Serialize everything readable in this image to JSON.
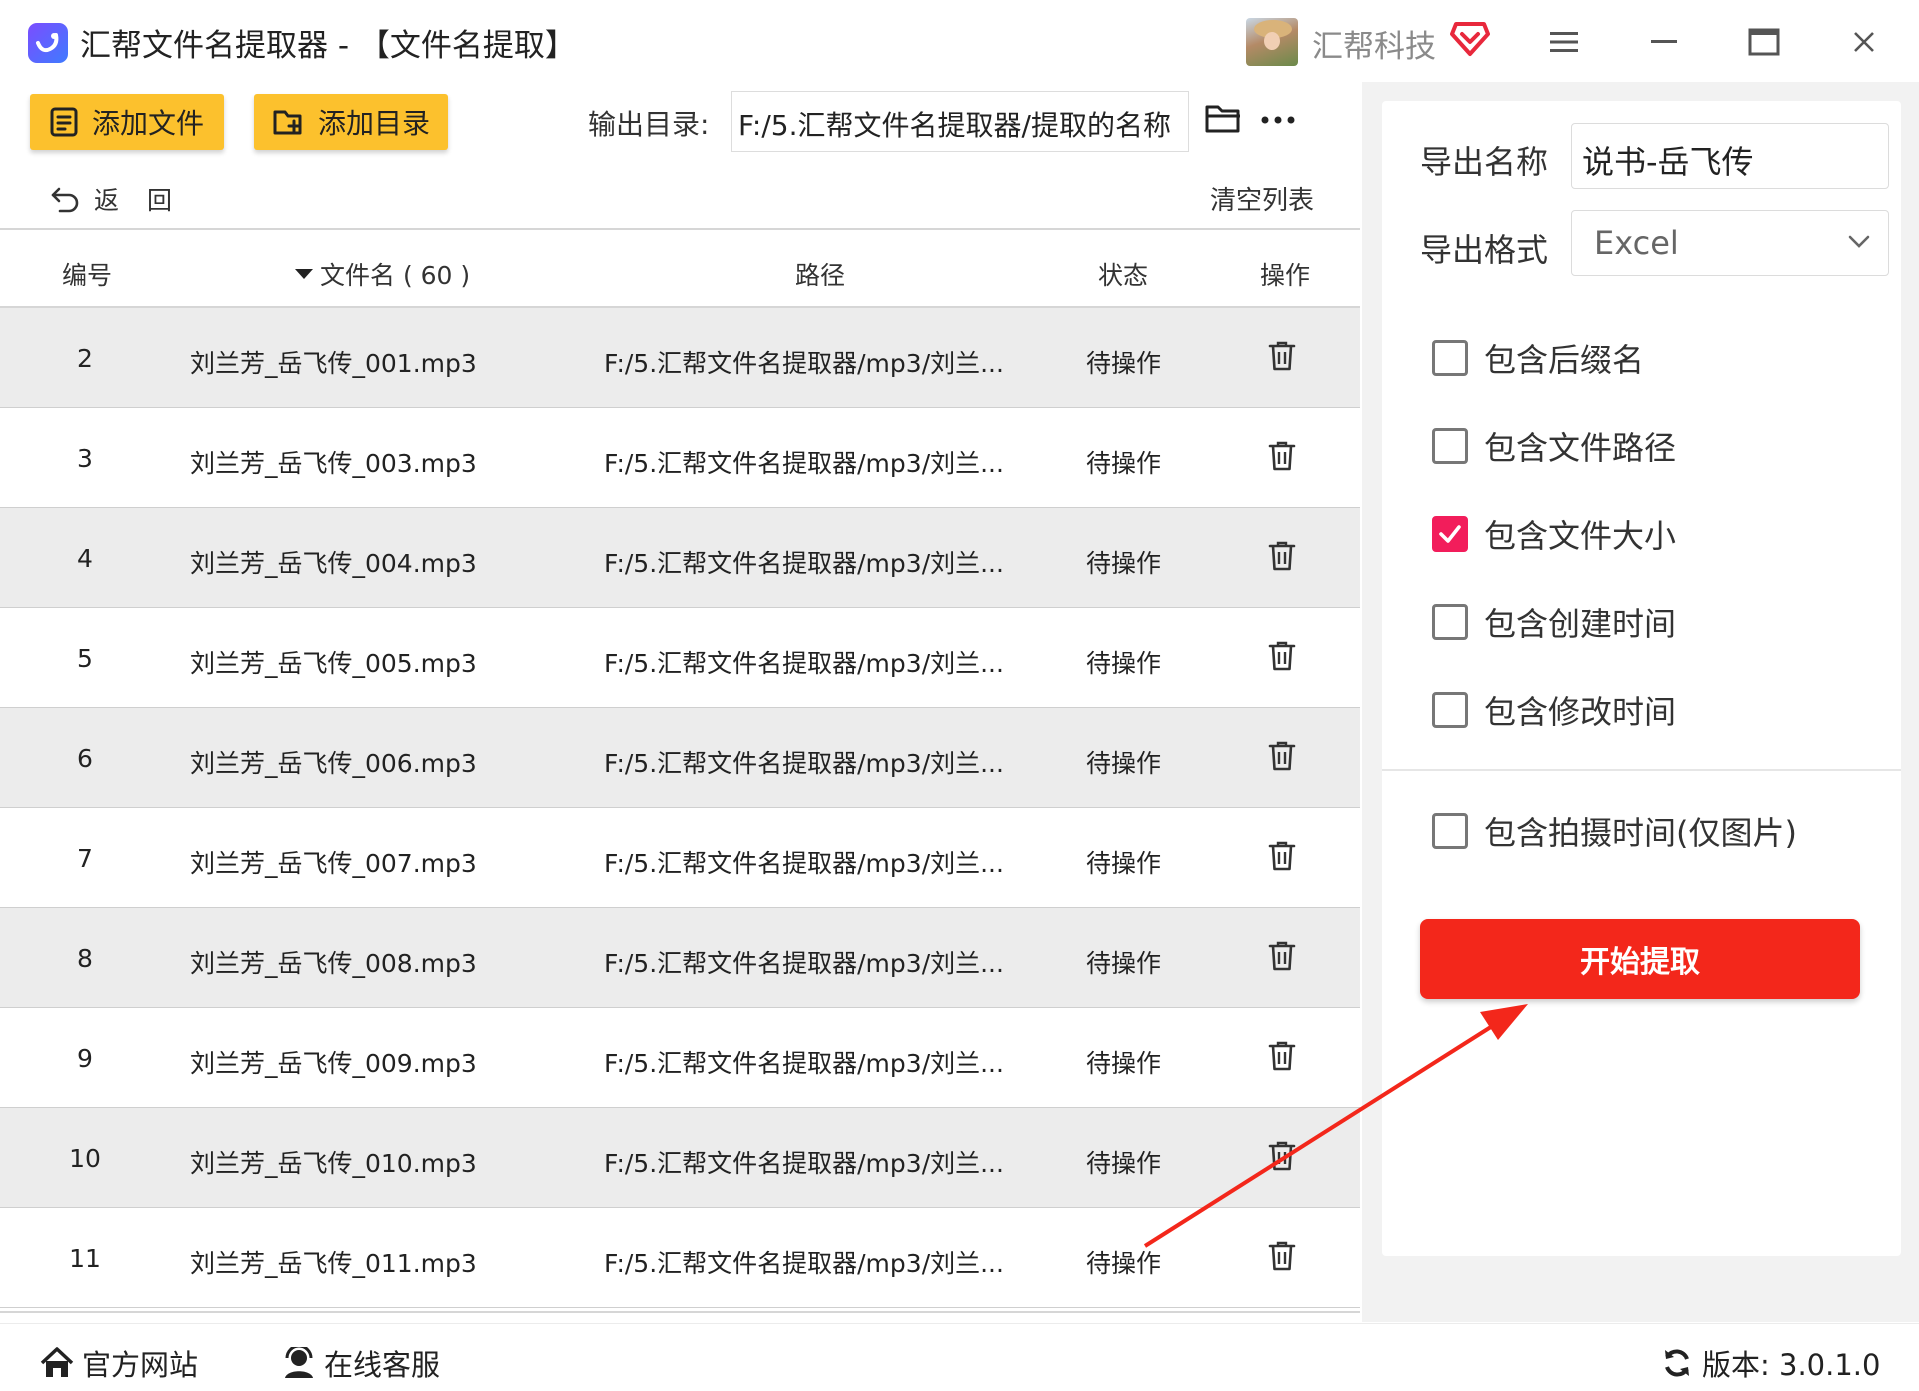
{
  "window": {
    "title": "汇帮文件名提取器 - 【文件名提取】",
    "company": "汇帮科技"
  },
  "toolbar": {
    "add_file_label": "添加文件",
    "add_dir_label": "添加目录",
    "output_label": "输出目录:",
    "output_value": "F:/5.汇帮文件名提取器/提取的名称",
    "back_label": "返 回",
    "clear_label": "清空列表"
  },
  "table": {
    "headers": {
      "num": "编号",
      "name": "文件名 ( 60 )",
      "path": "路径",
      "status": "状态",
      "op": "操作"
    },
    "rows": [
      {
        "num": "2",
        "name": "刘兰芳_岳飞传_001.mp3",
        "path": "F:/5.汇帮文件名提取器/mp3/刘兰...",
        "status": "待操作"
      },
      {
        "num": "3",
        "name": "刘兰芳_岳飞传_003.mp3",
        "path": "F:/5.汇帮文件名提取器/mp3/刘兰...",
        "status": "待操作"
      },
      {
        "num": "4",
        "name": "刘兰芳_岳飞传_004.mp3",
        "path": "F:/5.汇帮文件名提取器/mp3/刘兰...",
        "status": "待操作"
      },
      {
        "num": "5",
        "name": "刘兰芳_岳飞传_005.mp3",
        "path": "F:/5.汇帮文件名提取器/mp3/刘兰...",
        "status": "待操作"
      },
      {
        "num": "6",
        "name": "刘兰芳_岳飞传_006.mp3",
        "path": "F:/5.汇帮文件名提取器/mp3/刘兰...",
        "status": "待操作"
      },
      {
        "num": "7",
        "name": "刘兰芳_岳飞传_007.mp3",
        "path": "F:/5.汇帮文件名提取器/mp3/刘兰...",
        "status": "待操作"
      },
      {
        "num": "8",
        "name": "刘兰芳_岳飞传_008.mp3",
        "path": "F:/5.汇帮文件名提取器/mp3/刘兰...",
        "status": "待操作"
      },
      {
        "num": "9",
        "name": "刘兰芳_岳飞传_009.mp3",
        "path": "F:/5.汇帮文件名提取器/mp3/刘兰...",
        "status": "待操作"
      },
      {
        "num": "10",
        "name": "刘兰芳_岳飞传_010.mp3",
        "path": "F:/5.汇帮文件名提取器/mp3/刘兰...",
        "status": "待操作"
      },
      {
        "num": "11",
        "name": "刘兰芳_岳飞传_011.mp3",
        "path": "F:/5.汇帮文件名提取器/mp3/刘兰...",
        "status": "待操作"
      }
    ]
  },
  "settings": {
    "export_name_label": "导出名称",
    "export_name_value": "说书-岳飞传",
    "export_format_label": "导出格式",
    "export_format_value": "Excel",
    "options": [
      {
        "label": "包含后缀名",
        "checked": false
      },
      {
        "label": "包含文件路径",
        "checked": false
      },
      {
        "label": "包含文件大小",
        "checked": true
      },
      {
        "label": "包含创建时间",
        "checked": false
      },
      {
        "label": "包含修改时间",
        "checked": false
      },
      {
        "label": "包含拍摄时间(仅图片)",
        "checked": false
      }
    ],
    "start_label": "开始提取"
  },
  "footer": {
    "website_label": "官方网站",
    "support_label": "在线客服",
    "version_label": "版本: 3.0.1.0"
  },
  "colors": {
    "yellow_button": "#fcc12d",
    "start_button": "#f3271b",
    "checkbox_checked": "#f21d5b",
    "annotation_arrow": "#f3271b"
  }
}
